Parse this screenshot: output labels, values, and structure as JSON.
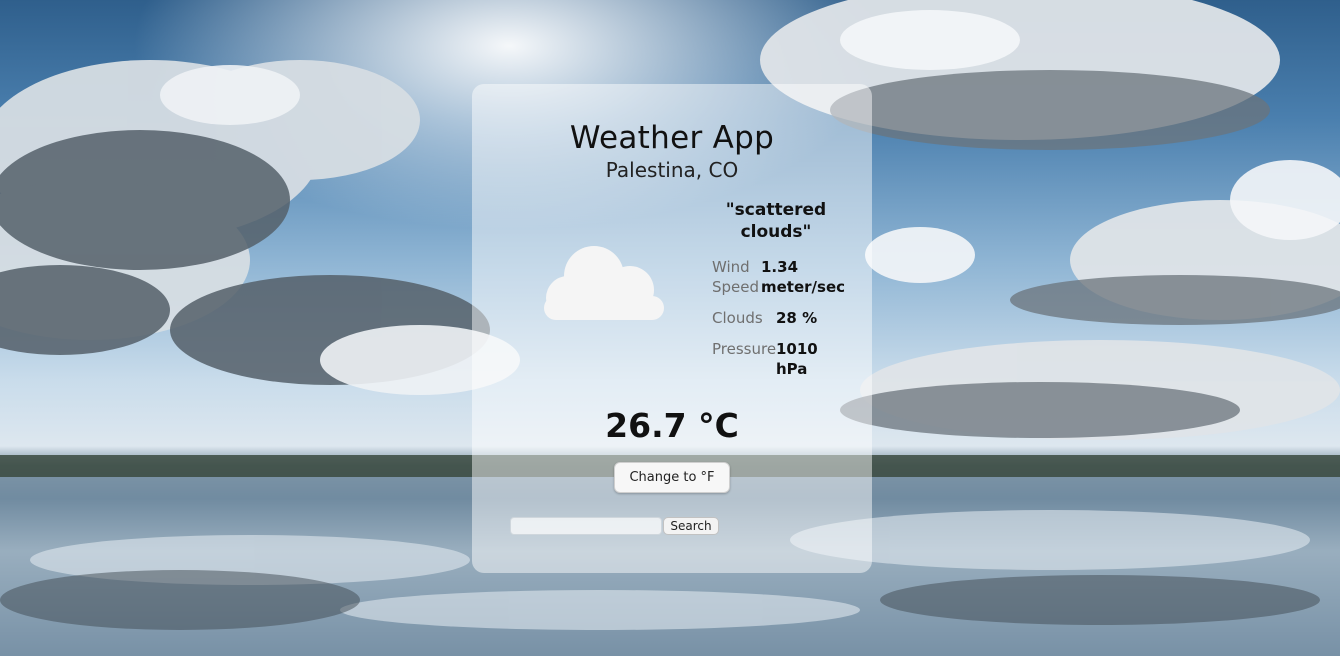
{
  "app": {
    "title": "Weather App",
    "city": "Palestina, CO"
  },
  "weather": {
    "icon": "cloud-icon",
    "description": "\"scattered clouds\"",
    "temperature": "26.7 °C",
    "stats": [
      {
        "label": "Wind Speed",
        "value": "1.34 meter/sec"
      },
      {
        "label": "Clouds",
        "value": "28 %"
      },
      {
        "label": "Pressure",
        "value": "1010 hPa"
      }
    ]
  },
  "controls": {
    "unit_toggle_label": "Change to °F",
    "search_placeholder": "",
    "search_value": "",
    "search_label": "Search"
  },
  "colors": {
    "sky": "#4a7fae",
    "card": "rgba(255,255,255,0.48)",
    "text": "#111111",
    "label": "#6f6f6f"
  }
}
